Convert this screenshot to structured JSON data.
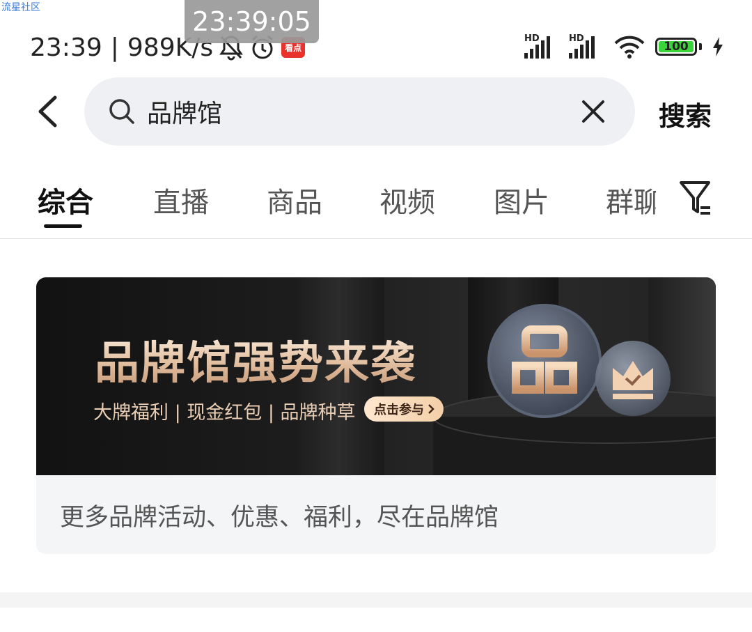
{
  "watermark": "流星社区",
  "clock_overlay": "23:39:05",
  "status_bar": {
    "time": "23:39",
    "separator": "|",
    "net_speed": "989K/s",
    "app_badge": "看点",
    "sim1_label": "HD",
    "sim2_label": "HD",
    "battery_level": "100",
    "icons": [
      "bell-off-icon",
      "alarm-icon",
      "app-badge-icon",
      "signal-icon",
      "signal-icon",
      "wifi-icon",
      "battery-icon",
      "charging-icon"
    ]
  },
  "search": {
    "query": "品牌馆",
    "submit_label": "搜索",
    "icons": [
      "back-arrow-icon",
      "search-icon",
      "clear-icon"
    ]
  },
  "tabs": [
    {
      "label": "综合",
      "active": true
    },
    {
      "label": "直播",
      "active": false
    },
    {
      "label": "商品",
      "active": false
    },
    {
      "label": "视频",
      "active": false
    },
    {
      "label": "图片",
      "active": false
    },
    {
      "label": "群聊",
      "active": false
    }
  ],
  "filter_icon": "filter-icon",
  "banner": {
    "title": "品牌馆强势来袭",
    "subtitle": "大牌福利 | 现金红包 | 品牌种草",
    "cta": "点击参与",
    "caption": "更多品牌活动、优惠、福利，尽在品牌馆"
  },
  "colors": {
    "accent_dark": "#111111",
    "search_bg": "#eff0f4",
    "banner_gold": "#e2bfa0",
    "battery_green": "#3bd43b"
  }
}
